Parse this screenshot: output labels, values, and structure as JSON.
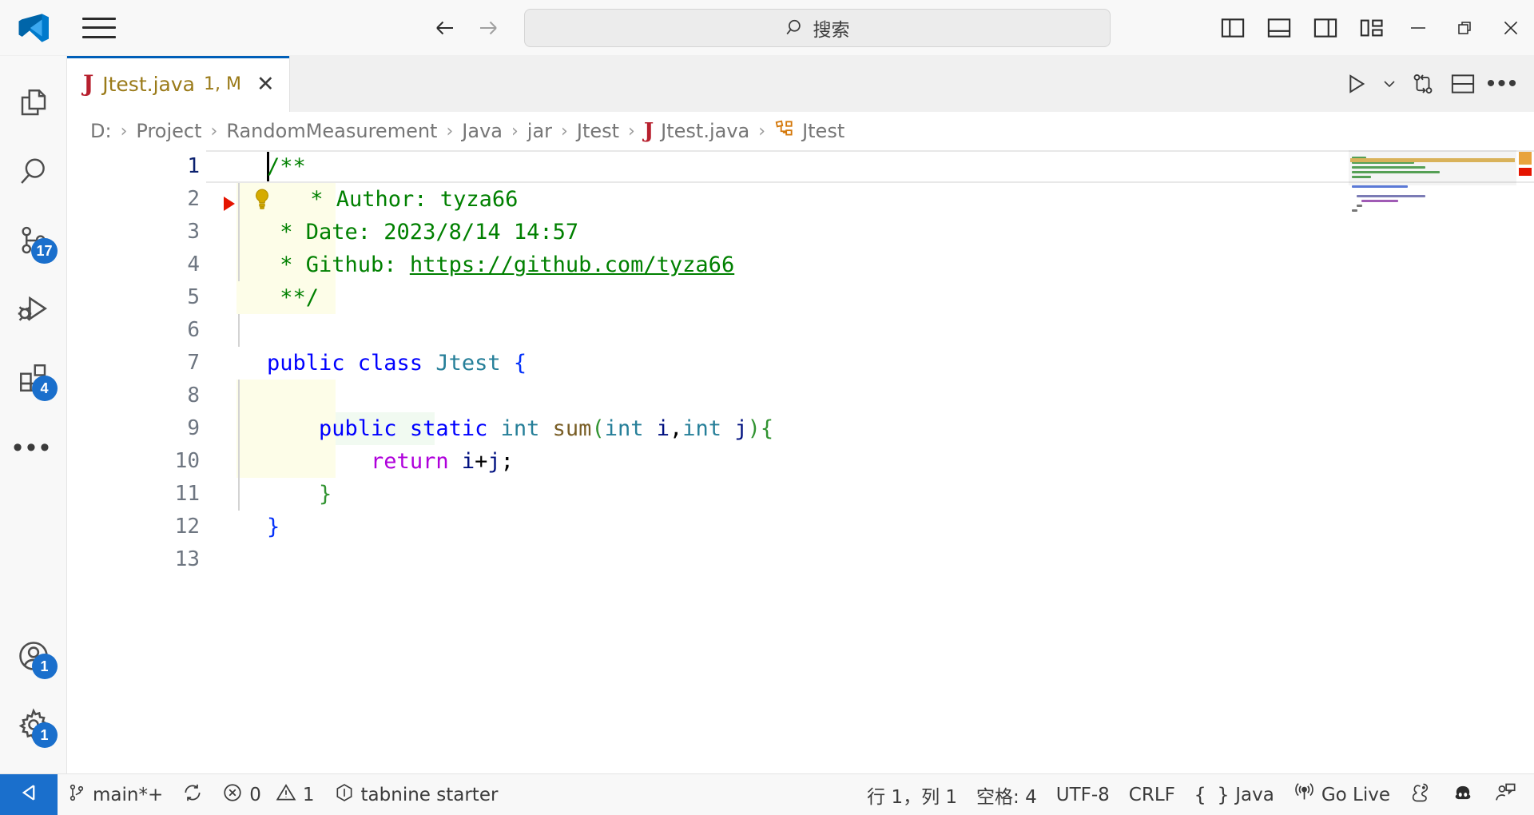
{
  "titlebar": {
    "logo": "vscode-logo",
    "menu_icon": "hamburger-menu-icon",
    "back_label": "←",
    "forward_label": "→",
    "search": {
      "placeholder": "搜索",
      "value": "",
      "icon": "search-icon"
    },
    "layout_buttons": [
      {
        "name": "toggle-primary-sidebar",
        "icon": "layout-sidebar-left-icon"
      },
      {
        "name": "toggle-panel",
        "icon": "layout-panel-icon"
      },
      {
        "name": "toggle-secondary-sidebar",
        "icon": "layout-sidebar-right-icon"
      },
      {
        "name": "customize-layout",
        "icon": "layout-customize-icon"
      }
    ],
    "window_controls": [
      {
        "name": "minimize",
        "glyph": "—"
      },
      {
        "name": "maximize",
        "glyph": "❐"
      },
      {
        "name": "close",
        "glyph": "✕"
      }
    ]
  },
  "activitybar": {
    "items": [
      {
        "name": "explorer",
        "icon": "files-icon",
        "badge": ""
      },
      {
        "name": "search",
        "icon": "search-icon",
        "badge": ""
      },
      {
        "name": "source-control",
        "icon": "source-control-icon",
        "badge": "17"
      },
      {
        "name": "run-and-debug",
        "icon": "run-debug-icon",
        "badge": ""
      },
      {
        "name": "extensions",
        "icon": "extensions-icon",
        "badge": "4"
      },
      {
        "name": "more-views",
        "icon": "ellipsis-icon",
        "badge": ""
      }
    ],
    "bottom": [
      {
        "name": "accounts",
        "icon": "account-icon",
        "badge": "1"
      },
      {
        "name": "manage-settings",
        "icon": "gear-icon",
        "badge": "1"
      }
    ]
  },
  "tabs": [
    {
      "icon": "java-file-icon",
      "icon_letter": "J",
      "label": "Jtest.java",
      "badge": "1, M",
      "close": "✕",
      "active": true
    }
  ],
  "editor_actions": [
    {
      "name": "run-java",
      "icon": "play-icon"
    },
    {
      "name": "run-options-dropdown",
      "icon": "chevron-down-icon"
    },
    {
      "name": "compare-changes",
      "icon": "git-compare-icon"
    },
    {
      "name": "split-editor-down",
      "icon": "split-editor-icon"
    },
    {
      "name": "more-actions",
      "icon": "ellipsis-icon"
    }
  ],
  "breadcrumbs": [
    {
      "label": "D:",
      "icon": ""
    },
    {
      "label": "Project",
      "icon": ""
    },
    {
      "label": "RandomMeasurement",
      "icon": ""
    },
    {
      "label": "Java",
      "icon": ""
    },
    {
      "label": "jar",
      "icon": ""
    },
    {
      "label": "Jtest",
      "icon": ""
    },
    {
      "label": "Jtest.java",
      "icon": "java-file-icon",
      "icon_letter": "J"
    },
    {
      "label": "Jtest",
      "icon": "symbol-class-icon"
    }
  ],
  "breadcrumb_separator": "›",
  "editor": {
    "language": "java",
    "line_numbers": [
      "1",
      "2",
      "3",
      "4",
      "5",
      "6",
      "7",
      "8",
      "9",
      "10",
      "11",
      "12",
      "13"
    ],
    "current_line": 1,
    "lines": [
      {
        "n": 1,
        "text": "/**"
      },
      {
        "n": 2,
        "text": " * Author: tyza66"
      },
      {
        "n": 3,
        "text": " * Date: 2023/8/14 14:57"
      },
      {
        "n": 4,
        "text": " * Github: https://github.com/tyza66"
      },
      {
        "n": 5,
        "text": " **/"
      },
      {
        "n": 6,
        "text": ""
      },
      {
        "n": 7,
        "text": "public class Jtest {"
      },
      {
        "n": 8,
        "text": ""
      },
      {
        "n": 9,
        "text": "    public static int sum(int i,int j){"
      },
      {
        "n": 10,
        "text": "        return i+j;"
      },
      {
        "n": 11,
        "text": "    }"
      },
      {
        "n": 12,
        "text": "}"
      },
      {
        "n": 13,
        "text": ""
      }
    ],
    "code_action_hint": "lightbulb-icon",
    "warning_glyph": "warning-marker",
    "link_url": "https://github.com/tyza66"
  },
  "statusbar": {
    "remote_icon": "remote-window-icon",
    "left": [
      {
        "name": "branch",
        "icon": "source-control-branch-icon",
        "label": "main*+"
      },
      {
        "name": "sync-changes",
        "icon": "sync-icon",
        "label": ""
      },
      {
        "name": "problems-errors",
        "icon": "error-icon",
        "label": "0"
      },
      {
        "name": "problems-warnings",
        "icon": "warning-icon",
        "label": "1"
      },
      {
        "name": "tabnine",
        "icon": "tabnine-icon",
        "label": "tabnine starter"
      }
    ],
    "right": [
      {
        "name": "cursor-position",
        "icon": "",
        "label": "行 1，列 1"
      },
      {
        "name": "indentation",
        "icon": "",
        "label": "空格: 4"
      },
      {
        "name": "encoding",
        "icon": "",
        "label": "UTF-8"
      },
      {
        "name": "eol",
        "icon": "",
        "label": "CRLF"
      },
      {
        "name": "language-mode",
        "icon": "braces-icon",
        "label": "Java"
      },
      {
        "name": "go-live",
        "icon": "broadcast-icon",
        "label": "Go Live"
      },
      {
        "name": "gitlens",
        "icon": "squirrel-icon",
        "label": ""
      },
      {
        "name": "copilot",
        "icon": "copilot-icon",
        "label": ""
      },
      {
        "name": "feedback",
        "icon": "feedback-icon",
        "label": ""
      }
    ]
  },
  "colors": {
    "accent": "#005fb8",
    "badge": "#1a6fcc",
    "modified_tab": "#9a7a18",
    "comment": "#008000",
    "keyword": "#0000ff",
    "type": "#267f99",
    "function": "#795e26",
    "control": "#af00db",
    "variable": "#001080",
    "error": "#e51400",
    "background": "#ffffff",
    "chrome": "#f8f8f8"
  }
}
